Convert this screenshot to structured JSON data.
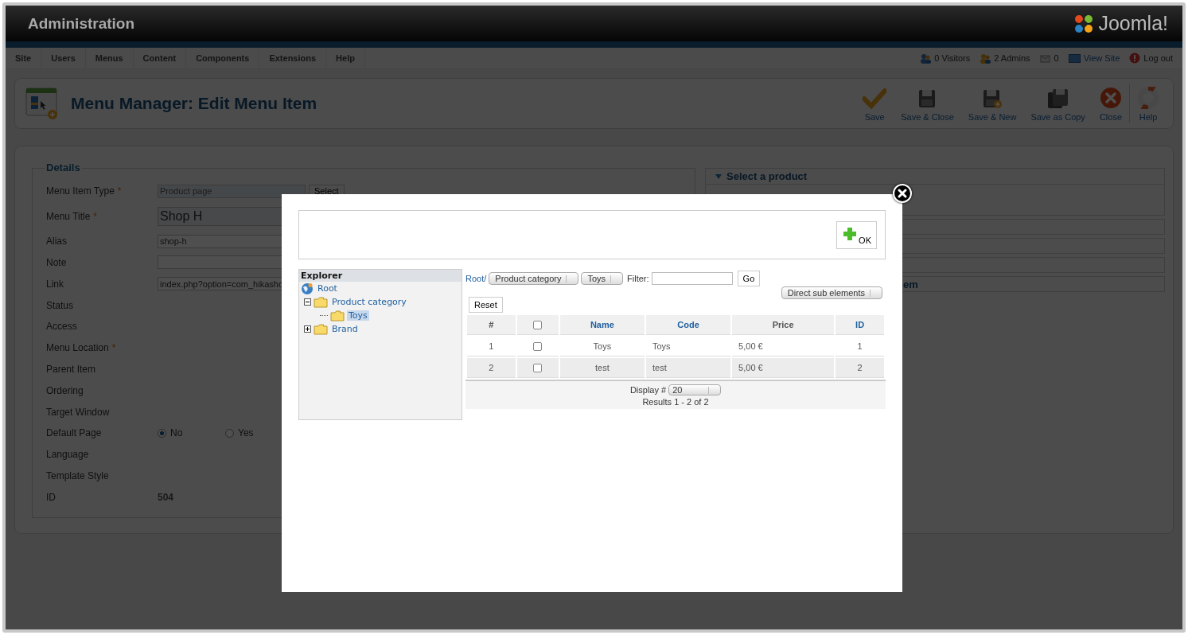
{
  "header": {
    "title": "Administration",
    "logo_text": "Joomla!"
  },
  "menu": [
    "Site",
    "Users",
    "Menus",
    "Content",
    "Components",
    "Extensions",
    "Help"
  ],
  "status": [
    {
      "kind": "visitors",
      "label": "0 Visitors"
    },
    {
      "kind": "admins",
      "label": "2 Admins"
    },
    {
      "kind": "messages",
      "label": "0"
    },
    {
      "kind": "view-site",
      "label": "View Site"
    },
    {
      "kind": "logout",
      "label": "Log out"
    }
  ],
  "page_title": "Menu Manager: Edit Menu Item",
  "toolbar": [
    {
      "kind": "save",
      "label": "Save"
    },
    {
      "kind": "save-close",
      "label": "Save & Close"
    },
    {
      "kind": "save-new",
      "label": "Save & New"
    },
    {
      "kind": "save-copy",
      "label": "Save as Copy"
    },
    {
      "kind": "close",
      "label": "Close"
    },
    {
      "kind": "help",
      "label": "Help"
    }
  ],
  "details": {
    "legend": "Details",
    "fields": [
      {
        "label": "Menu Item Type",
        "marker": "*",
        "kind": "type",
        "value": "Product page",
        "button": "Select"
      },
      {
        "label": "Menu Title",
        "marker": "*",
        "kind": "title",
        "value": "Shop H"
      },
      {
        "label": "Alias",
        "kind": "text",
        "value": "shop-h"
      },
      {
        "label": "Note",
        "kind": "text"
      },
      {
        "label": "Link",
        "kind": "text",
        "value": "index.php?option=com_hikasho"
      },
      {
        "label": "Status",
        "kind": "none"
      },
      {
        "label": "Access",
        "kind": "none"
      },
      {
        "label": "Menu Location",
        "marker": "*",
        "kind": "none"
      },
      {
        "label": "Parent Item",
        "kind": "none"
      },
      {
        "label": "Ordering",
        "kind": "none"
      },
      {
        "label": "Target Window",
        "kind": "none"
      },
      {
        "label": "Default Page",
        "kind": "radio",
        "options": [
          {
            "label": "No",
            "selected": true
          },
          {
            "label": "Yes",
            "selected": false
          }
        ]
      },
      {
        "label": "Language",
        "kind": "none"
      },
      {
        "label": "Template Style",
        "kind": "none"
      },
      {
        "label": "ID",
        "kind": "readonly",
        "value": "504"
      }
    ]
  },
  "right_panel": [
    {
      "kind": "open",
      "title": "Select a product",
      "expanded": true
    },
    {
      "kind": "blank"
    },
    {
      "kind": "blank"
    },
    {
      "kind": "blank"
    },
    {
      "kind": "cut",
      "title": "em"
    }
  ],
  "modal": {
    "ok_label": "OK",
    "explorer": {
      "title": "Explorer",
      "tree": [
        {
          "label": "Root",
          "kind": "root",
          "selected": false,
          "children": [
            {
              "label": "Product category",
              "kind": "folder",
              "selected": false,
              "expanded": true,
              "children": [
                {
                  "label": "Toys",
                  "kind": "folder",
                  "selected": true
                }
              ]
            },
            {
              "label": "Brand",
              "kind": "folder",
              "selected": false,
              "expanded": false
            }
          ]
        }
      ]
    },
    "breadcrumb": "Root/",
    "selects": [
      "Product category",
      "Toys"
    ],
    "filter_label": "Filter:",
    "go": "Go",
    "mode": "Direct sub elements",
    "reset": "Reset",
    "columns": [
      {
        "kind": "text",
        "label": "#",
        "link": false
      },
      {
        "kind": "checkbox",
        "checked": false
      },
      {
        "kind": "text",
        "label": "Name",
        "link": true
      },
      {
        "kind": "text",
        "label": "Code",
        "link": true
      },
      {
        "kind": "text",
        "label": "Price",
        "link": false
      },
      {
        "kind": "text",
        "label": "ID",
        "link": true
      }
    ],
    "rows": [
      {
        "num": "1",
        "checked": false,
        "name": "Toys",
        "code": "Toys",
        "price": "5,00 €",
        "id": "1"
      },
      {
        "num": "2",
        "checked": false,
        "name": "test",
        "code": "test",
        "price": "5,00 €",
        "id": "2"
      }
    ],
    "display_label": "Display #",
    "display_value": "20",
    "results": "Results 1 - 2 of 2"
  }
}
